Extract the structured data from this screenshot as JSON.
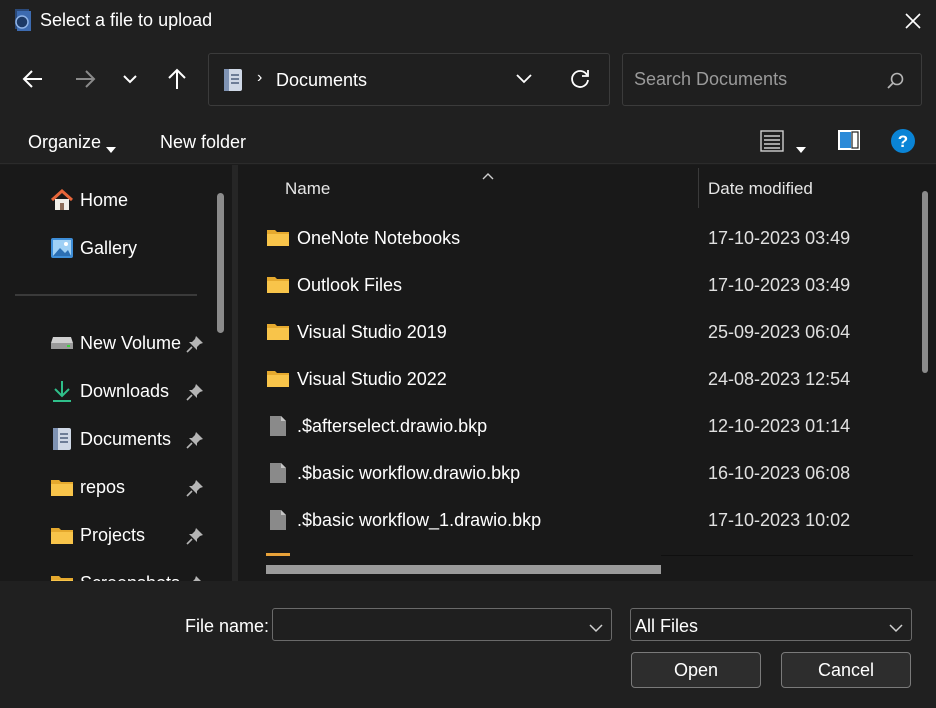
{
  "window": {
    "title": "Select a file to upload",
    "app_icon": "app-icon",
    "close_icon": "close-icon"
  },
  "nav": {
    "back_icon": "arrow-left-icon",
    "forward_icon": "arrow-right-icon",
    "recent_icon": "chevron-down-icon",
    "up_icon": "arrow-up-icon",
    "address": {
      "separator": "›",
      "path": "Documents"
    },
    "search_placeholder": "Search Documents"
  },
  "commands": {
    "organize": "Organize",
    "new_folder": "New folder"
  },
  "sidebar": {
    "quick": [
      {
        "label": "Home",
        "icon": "home-icon"
      },
      {
        "label": "Gallery",
        "icon": "gallery-icon"
      }
    ],
    "pinned": [
      {
        "label": "New Volume",
        "icon": "drive-icon"
      },
      {
        "label": "Downloads",
        "icon": "download-icon"
      },
      {
        "label": "Documents",
        "icon": "document-icon"
      },
      {
        "label": "repos",
        "icon": "folder-icon"
      },
      {
        "label": "Projects",
        "icon": "folder-icon"
      },
      {
        "label": "Screenshots",
        "icon": "folder-icon"
      }
    ]
  },
  "columns": {
    "name": "Name",
    "date_modified": "Date modified"
  },
  "files": [
    {
      "name": "OneNote Notebooks",
      "date": "17-10-2023 03:49",
      "type": "folder"
    },
    {
      "name": "Outlook Files",
      "date": "17-10-2023 03:49",
      "type": "folder"
    },
    {
      "name": "Visual Studio 2019",
      "date": "25-09-2023 06:04",
      "type": "folder"
    },
    {
      "name": "Visual Studio 2022",
      "date": "24-08-2023 12:54",
      "type": "folder"
    },
    {
      "name": ".$afterselect.drawio.bkp",
      "date": "12-10-2023 01:14",
      "type": "file"
    },
    {
      "name": ".$basic workflow.drawio.bkp",
      "date": "16-10-2023 06:08",
      "type": "file"
    },
    {
      "name": ".$basic workflow_1.drawio.bkp",
      "date": "17-10-2023 10:02",
      "type": "file"
    }
  ],
  "footer": {
    "file_name_label": "File name:",
    "file_name_value": "",
    "file_type": "All Files",
    "open": "Open",
    "cancel": "Cancel"
  },
  "colors": {
    "folder": "#f8c44a",
    "accent": "#0a84d6",
    "home_roof": "#e8663a"
  }
}
